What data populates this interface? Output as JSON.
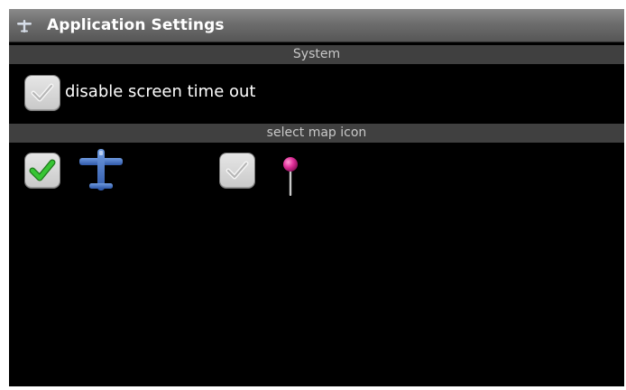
{
  "title_bar": {
    "icon": "airplane-icon",
    "title": "Application Settings"
  },
  "sections": {
    "system": {
      "header": "System",
      "disable_screen_timeout": {
        "label": "disable screen time out",
        "checked": false
      }
    },
    "map_icon": {
      "header": "select map icon",
      "options": [
        {
          "icon": "airplane-icon",
          "checked": true
        },
        {
          "icon": "map-pin-icon",
          "checked": false
        }
      ]
    }
  },
  "colors": {
    "background": "#000000",
    "section_header_bg": "#404040",
    "checkmark_active": "#2fb82c",
    "airplane_blue": "#3f6fc0",
    "pin_magenta": "#e0309a"
  }
}
